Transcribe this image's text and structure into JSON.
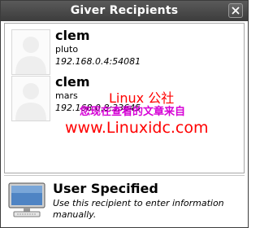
{
  "window": {
    "title": "Giver Recipients"
  },
  "recipients": [
    {
      "name": "clem",
      "host": "pluto",
      "address": "192.168.0.4:54081"
    },
    {
      "name": "clem",
      "host": "mars",
      "address": "192.168.0.8:33645"
    }
  ],
  "watermark": {
    "line1": "Linux 公社",
    "line2": "您现在查看的文章来自",
    "line3": "www.Linuxidc.com"
  },
  "user_specified": {
    "title": "User Specified",
    "description": "Use this recipient to enter information manually."
  },
  "icons": [
    "close-icon",
    "person-silhouette-icon",
    "computer-monitor-icon"
  ]
}
